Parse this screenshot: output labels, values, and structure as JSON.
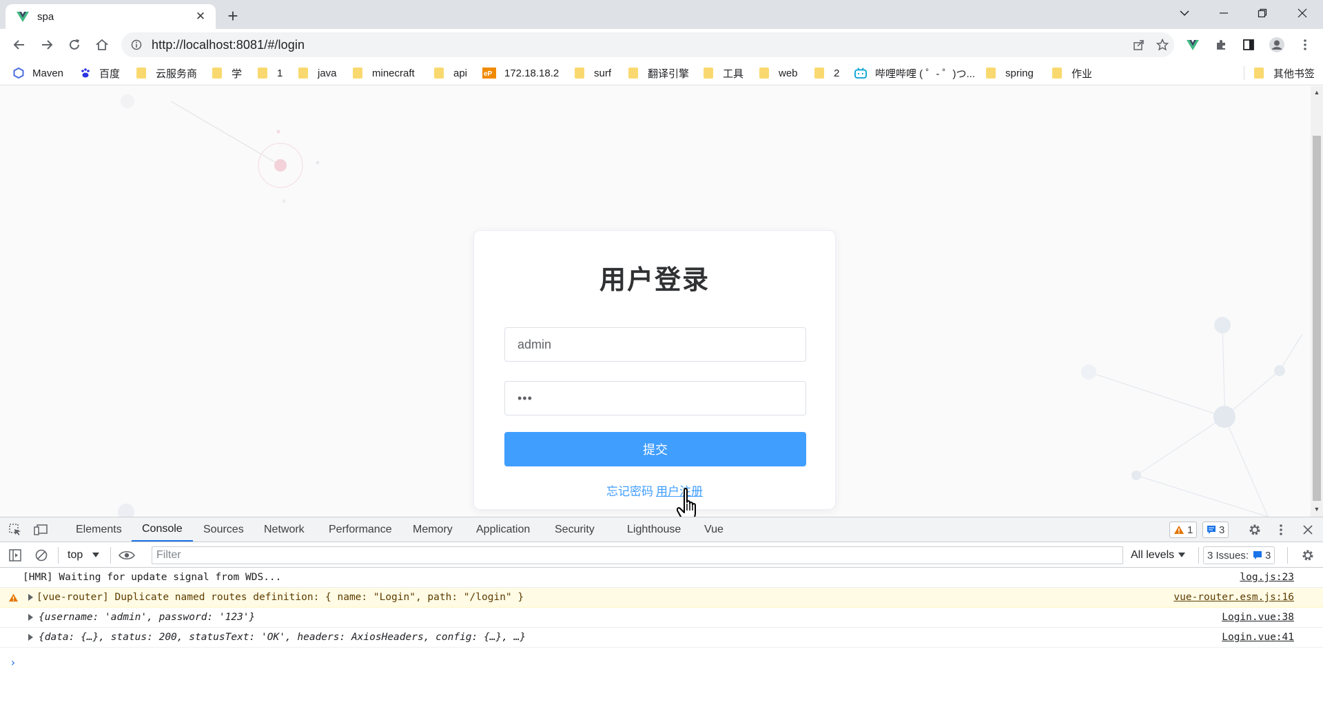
{
  "tab": {
    "title": "spa"
  },
  "omnibox": {
    "url": "http://localhost:8081/#/login"
  },
  "bookmarks": [
    {
      "label": "Maven",
      "icon": "maven-icon"
    },
    {
      "label": "百度",
      "icon": "baidu-paw-icon"
    },
    {
      "label": "云服务商",
      "icon": "folder-icon"
    },
    {
      "label": "学",
      "icon": "folder-icon"
    },
    {
      "label": "1",
      "icon": "folder-icon"
    },
    {
      "label": "java",
      "icon": "folder-icon"
    },
    {
      "label": "minecraft",
      "icon": "folder-icon"
    },
    {
      "label": "api",
      "icon": "folder-icon"
    },
    {
      "label": "172.18.18.2",
      "icon": "ep-icon"
    },
    {
      "label": "surf",
      "icon": "folder-icon"
    },
    {
      "label": "翻译引擎",
      "icon": "folder-icon"
    },
    {
      "label": "工具",
      "icon": "folder-icon"
    },
    {
      "label": "web",
      "icon": "folder-icon"
    },
    {
      "label": "2",
      "icon": "folder-icon"
    },
    {
      "label": "哔哩哔哩 ( ゜- ゜)つ...",
      "icon": "bilibili-icon"
    },
    {
      "label": "spring",
      "icon": "folder-icon"
    },
    {
      "label": "作业",
      "icon": "folder-icon"
    }
  ],
  "other_bookmarks": "其他书签",
  "login": {
    "title": "用户登录",
    "username": "admin",
    "password_mask": "•••",
    "submit": "提交",
    "forgot": "忘记密码",
    "register": "用户注册"
  },
  "devtools": {
    "tabs": [
      "Elements",
      "Console",
      "Sources",
      "Network",
      "Performance",
      "Memory",
      "Application",
      "Security",
      "Lighthouse",
      "Vue"
    ],
    "active_tab": "Console",
    "warn_count": "1",
    "msg_count": "3",
    "context": "top",
    "filter_placeholder": "Filter",
    "levels": "All levels",
    "issues_label": "3 Issues:",
    "issues_count": "3",
    "lines": [
      {
        "text": "[HMR] Waiting for update signal from WDS...",
        "source": "log.js:23"
      },
      {
        "text": "[vue-router] Duplicate named routes definition: { name: \"Login\", path: \"/login\" }",
        "source": "vue-router.esm.js:16"
      },
      {
        "text": "{username: 'admin', password: '123'}",
        "source": "Login.vue:38"
      },
      {
        "text": "{data: {…}, status: 200, statusText: 'OK', headers: AxiosHeaders, config: {…}, …}",
        "source": "Login.vue:41"
      }
    ]
  },
  "colors": {
    "primary": "#409eff",
    "devtools_accent": "#1a73e8",
    "warning_bg": "#fffbe5"
  }
}
